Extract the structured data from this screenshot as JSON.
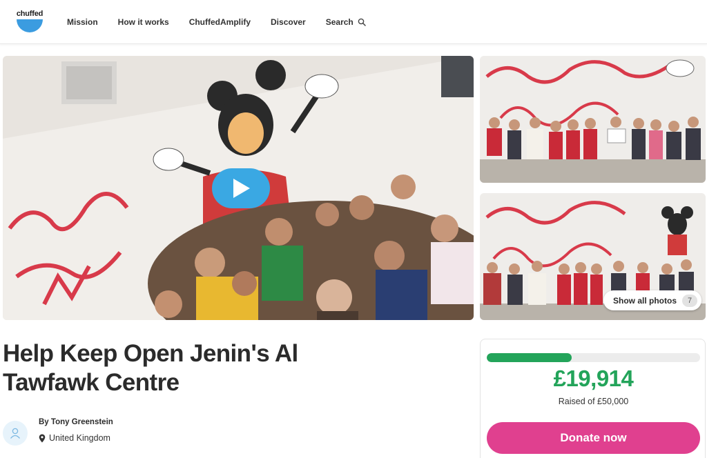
{
  "brand": {
    "logo_text": "chuffed",
    "accent": "#3b9ce0"
  },
  "nav": {
    "items": [
      {
        "label": "Mission"
      },
      {
        "label": "How it works"
      },
      {
        "label": "ChuffedAmplify"
      },
      {
        "label": "Discover"
      },
      {
        "label": "Search",
        "icon": "search-icon"
      }
    ]
  },
  "gallery": {
    "hero": {
      "kind": "video",
      "play_icon": "play-icon"
    },
    "thumbnails": 2,
    "show_all_label": "Show all photos",
    "photo_count": "7"
  },
  "campaign": {
    "title": "Help Keep Open Jenin's Al Tawfawk Centre",
    "organizer": "By Tony Greenstein",
    "location": "United Kingdom",
    "avatar_icon": "user-icon",
    "location_icon": "map-pin-icon"
  },
  "donation": {
    "raised": "£19,914",
    "raised_of": "Raised of £50,000",
    "progress_fraction": 0.398,
    "button_label": "Donate now",
    "progress_color": "#23a45a",
    "button_color": "#e0408f"
  }
}
